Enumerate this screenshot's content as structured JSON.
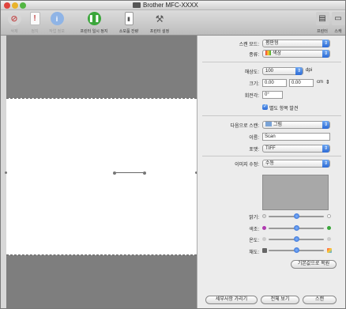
{
  "window": {
    "title": "Brother MFC-XXXX"
  },
  "toolbar": {
    "items": [
      {
        "label": "삭제",
        "icon": "delete-icon",
        "color": "#c24a4a"
      },
      {
        "label": "정지",
        "icon": "stop-icon",
        "color": "#c24a4a"
      },
      {
        "label": "작업 정보",
        "icon": "info-icon",
        "color": "#3b73c7"
      },
      {
        "label": "프린터 일시 정지",
        "icon": "pause-icon",
        "color": "#3aa63a"
      },
      {
        "label": "소모품 잔량",
        "icon": "supplies-icon",
        "color": "#777777"
      },
      {
        "label": "프린터 설정",
        "icon": "utility-icon",
        "color": "#777777"
      },
      {
        "label": "프린터",
        "icon": "printer-icon",
        "color": "#777777"
      },
      {
        "label": "스캐",
        "icon": "scanner-icon",
        "color": "#777777"
      }
    ]
  },
  "panel": {
    "scan_mode_label": "스캔 모드:",
    "scan_mode_value": "평판형",
    "kind_label": "종류:",
    "kind_value": "색상",
    "resolution_label": "해상도:",
    "resolution_value": "100",
    "resolution_unit": "dpi",
    "size_label": "크기:",
    "size_w": "0.00",
    "size_h": "0.00",
    "size_unit": "cm",
    "rotation_label": "회전각:",
    "rotation_value": "0°",
    "detect_label": "별도 항목 발견",
    "scan_to_label": "다음으로 스캔:",
    "scan_to_value": "그림",
    "name_label": "이름:",
    "name_value": "Scan",
    "format_label": "포맷:",
    "format_value": "TIFF",
    "correction_label": "이미지 수정:",
    "correction_value": "수동",
    "brightness_label": "밝기:",
    "tint_label": "색조:",
    "temperature_label": "온도:",
    "saturation_label": "채도:",
    "brightness_level": 0.5,
    "tint_level": 0.5,
    "temperature_level": 0.5,
    "saturation_level": 0.5,
    "restore_label": "기본값으로 복원",
    "hide_details_label": "세부사항 가리기",
    "overview_label": "전체 보기",
    "scan_label": "스캔"
  },
  "colors": {
    "accent": "#2d6bd6",
    "preview_bg": "#7e7e7e"
  }
}
